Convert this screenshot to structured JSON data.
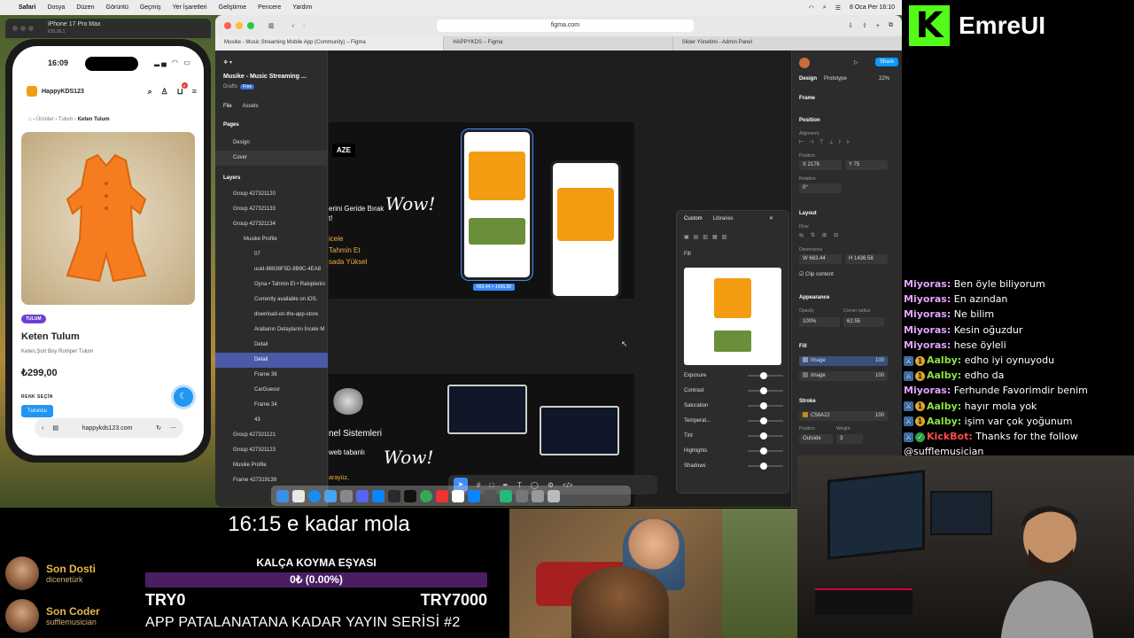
{
  "menubar": {
    "app": "Safari",
    "items": [
      "Dosya",
      "Düzen",
      "Görüntü",
      "Geçmiş",
      "Yer İşaretleri",
      "Geliştirme",
      "Pencere",
      "Yardım"
    ],
    "datetime": "8 Oca Per  16:10"
  },
  "simulator": {
    "device": "iPhone 17 Pro Max",
    "os": "iOS 26.1",
    "time": "16:09",
    "store_name": "HappyKDS123",
    "cart_count": "0",
    "breadcrumb": {
      "home": "Ürünler",
      "cat": "Tulum",
      "current": "Keten Tulum"
    },
    "tag": "TULUM",
    "product_name": "Keten Tulum",
    "product_desc": "Keten,Şort Boy Romper Tulum",
    "price": "₺299,00",
    "color_label": "RENK SEÇİN",
    "color_option": "Turuncu",
    "url": "happykds123.com"
  },
  "browser": {
    "url": "figma.com",
    "tabs": [
      "Musike - Music Streaming Mobile App (Community) – Figma",
      "HAPPYKDS – Figma",
      "Slider Yönetimi - Admin Panel"
    ]
  },
  "figma": {
    "file_title": "Musike - Music Streaming ...",
    "drafts": "Drafts",
    "plan": "Free",
    "file_tab": "File",
    "assets_tab": "Assets",
    "pages_label": "Pages",
    "pages": [
      "Design",
      "Cover"
    ],
    "layers_label": "Layers",
    "layers": [
      "Group 427321120",
      "Group 427321133",
      "Group 427321134",
      "Musike Profile",
      "07",
      "uuid-86838F5D-8B9C-4EA8",
      "Oyna • Tahmin Et • Rakiplerini",
      "Currently available on iOS.",
      "download-on-the-app-store",
      "Arabanın Detaylarını İncele M",
      "Detail",
      "Detail",
      "Frame 36",
      "CarGuessr",
      "Frame 34",
      "43",
      "Group 427321121",
      "Group 427321123",
      "Musike Profile",
      "Frame 427319139"
    ],
    "canvas": {
      "brand": "AZE",
      "line1": "erini Geride Bırak",
      "line1b": "t!",
      "wow": "Wow!",
      "y1": "icele",
      "y2": "Tahmin Et",
      "y3": "sada Yüksel",
      "line2": "nel Sistemleri",
      "line2b": "web tabanlı",
      "line2c": "arayüz,",
      "size_badge": "663.44 × 1436.58"
    },
    "popup": {
      "tabs": [
        "Custom",
        "Libraries"
      ],
      "fill": "Fill",
      "adjustments": [
        "Exposure",
        "Contrast",
        "Saturation",
        "Temperat...",
        "Tint",
        "Highlights",
        "Shadows"
      ]
    },
    "right": {
      "tabs": [
        "Design",
        "Prototype"
      ],
      "zoom": "22%",
      "share": "Share",
      "frame": "Frame",
      "position": "Position",
      "alignment": "Alignment",
      "position_sub": "Position",
      "x": "X  2176",
      "y": "Y  75",
      "rotation": "Rotation",
      "rot_val": "0°",
      "layout": "Layout",
      "flow": "Flow",
      "dimensions": "Dimensions",
      "w": "W  663.44",
      "h": "H  1436.58",
      "clip": "Clip content",
      "appearance": "Appearance",
      "opacity_lbl": "Opacity",
      "opacity": "100%",
      "radius_lbl": "Corner radius",
      "radius": "62.55",
      "fill": "Fill",
      "fills": [
        {
          "name": "Image",
          "pct": "100"
        },
        {
          "name": "Image",
          "pct": "100"
        }
      ],
      "stroke": "Stroke",
      "stroke_color": "C58A22",
      "stroke_pct": "100",
      "stroke_pos_lbl": "Position",
      "stroke_weight_lbl": "Weight",
      "stroke_pos": "Outside",
      "stroke_weight": "3"
    }
  },
  "stream": {
    "brand": "EmreUI",
    "chat": [
      {
        "user": "Miyoras:",
        "msg": "Ben öyle biliyorum",
        "badge": ""
      },
      {
        "user": "Miyoras:",
        "msg": "En azından",
        "badge": ""
      },
      {
        "user": "Miyoras:",
        "msg": "Ne bilim",
        "badge": ""
      },
      {
        "user": "Miyoras:",
        "msg": "Kesin oğuzdur",
        "badge": ""
      },
      {
        "user": "Miyoras:",
        "msg": "hese öyleli",
        "badge": ""
      },
      {
        "user": "Aalby:",
        "msg": "edho iyi oynuyodu",
        "badge": "1"
      },
      {
        "user": "Aalby:",
        "msg": "edho da",
        "badge": "1"
      },
      {
        "user": "Miyoras:",
        "msg": "Ferhunde Favorimdir benim",
        "badge": ""
      },
      {
        "user": "Aalby:",
        "msg": "hayır mola yok",
        "badge": "1"
      },
      {
        "user": "Aalby:",
        "msg": "işim var çok yoğunum",
        "badge": "1"
      },
      {
        "user": "KickBot:",
        "msg": "Thanks for the follow",
        "badge": "bot"
      },
      {
        "user": "",
        "msg": "@sufflemusician",
        "badge": ""
      }
    ],
    "break_text": "16:15 e kadar mola",
    "last_follower_label": "Son Dosti",
    "last_follower": "dicenetürk",
    "last_coder_label": "Son Coder",
    "last_coder": "sufflemusician",
    "goal_title": "KALÇA KOYMA EŞYASI",
    "goal_progress": "0₺ (0.00%)",
    "goal_min": "TRY0",
    "goal_max": "TRY7000",
    "series": "APP PATALANATANA KADAR YAYIN SERİSİ #2"
  }
}
